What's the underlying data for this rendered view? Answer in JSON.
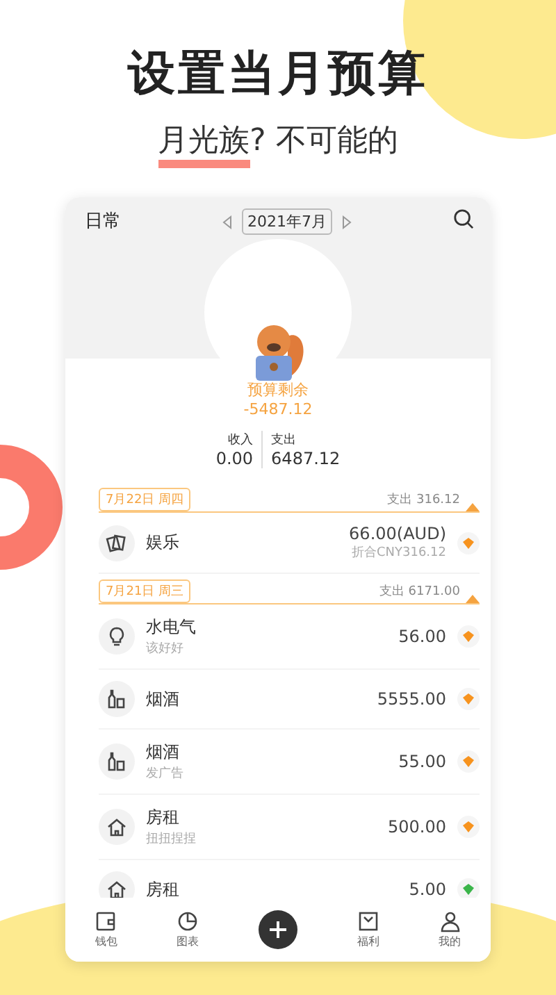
{
  "headline": "设置当月预算",
  "subtitle": {
    "highlight": "月光族",
    "rest": "? 不可能的"
  },
  "app": {
    "book": "日常",
    "month": "2021年7月",
    "budget": {
      "label": "预算剩余",
      "value": "-5487.12"
    },
    "income": {
      "label": "收入",
      "value": "0.00"
    },
    "expense": {
      "label": "支出",
      "value": "6487.12"
    },
    "days": [
      {
        "date": "7月22日 周四",
        "total": "支出 316.12",
        "entries": [
          {
            "kind": "fun",
            "category": "娱乐",
            "amount": "66.00(AUD)",
            "converted": "折合CNY316.12",
            "color": "#f7931e"
          }
        ]
      },
      {
        "date": "7月21日 周三",
        "total": "支出 6171.00",
        "entries": [
          {
            "kind": "bulb",
            "category": "水电气",
            "note": "该好好",
            "amount": "56.00",
            "color": "#f7931e"
          },
          {
            "kind": "bottle",
            "category": "烟酒",
            "amount": "5555.00",
            "color": "#f7931e"
          },
          {
            "kind": "bottle",
            "category": "烟酒",
            "note": "发广告",
            "amount": "55.00",
            "color": "#f7931e"
          },
          {
            "kind": "house",
            "category": "房租",
            "note": "扭扭捏捏",
            "amount": "500.00",
            "color": "#f7931e"
          },
          {
            "kind": "house",
            "category": "房租",
            "amount": "5.00",
            "color": "#3bb54a"
          }
        ]
      }
    ],
    "nav": [
      {
        "kind": "wallet",
        "label": "钱包",
        "selected": false
      },
      {
        "kind": "chart",
        "label": "图表",
        "selected": false
      },
      {
        "kind": "add"
      },
      {
        "kind": "gift",
        "label": "福利",
        "selected": false
      },
      {
        "kind": "user",
        "label": "我的",
        "selected": false
      }
    ]
  }
}
